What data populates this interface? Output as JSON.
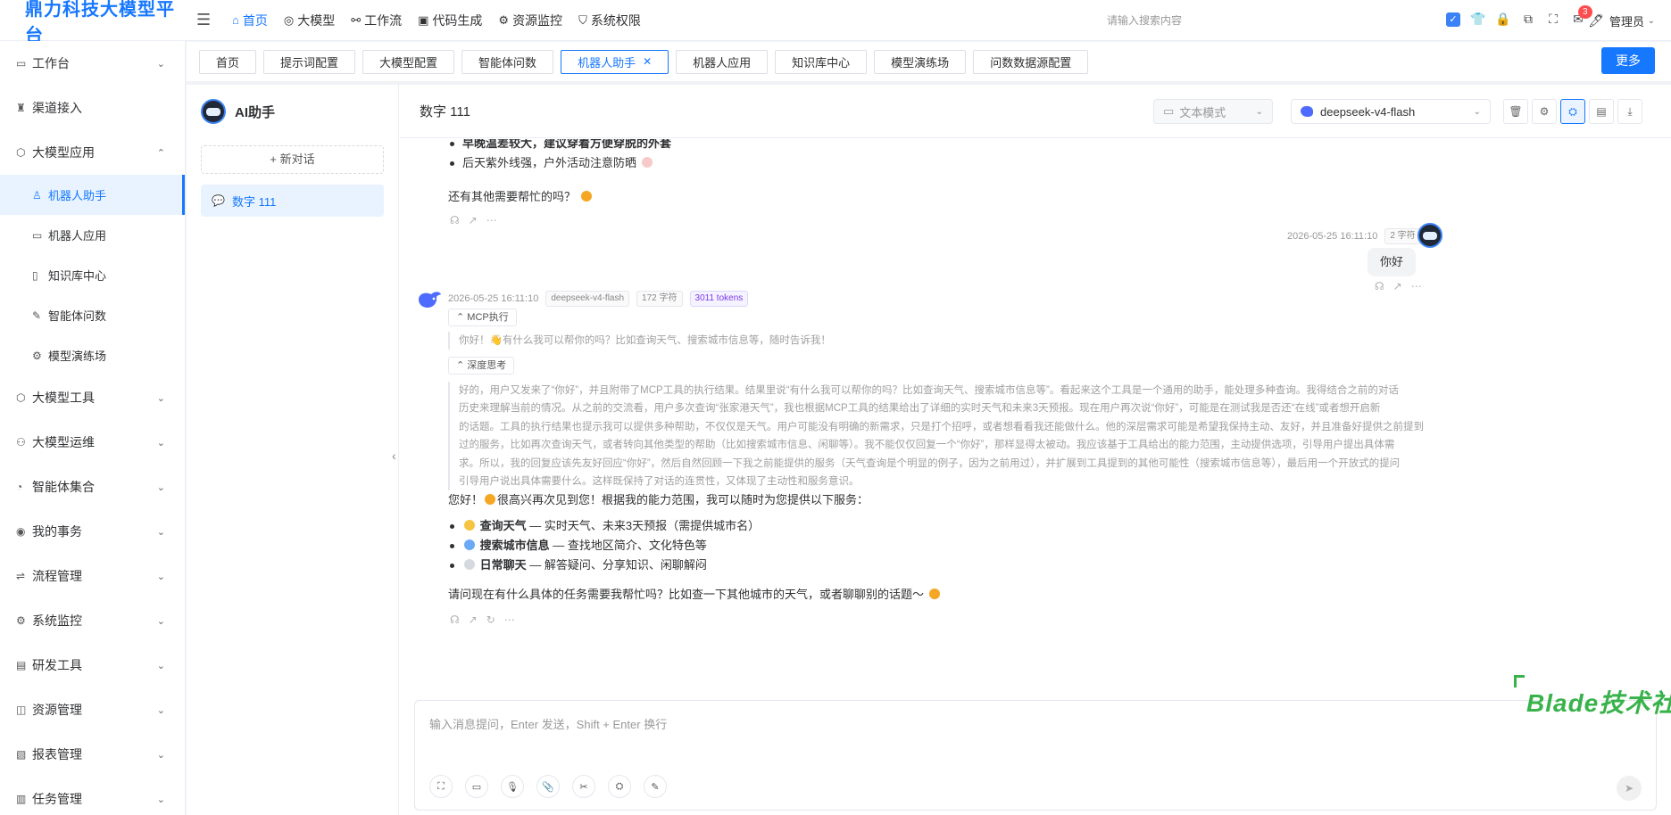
{
  "header": {
    "brand": "鼎力科技大模型平台",
    "nav": [
      {
        "label": "首页",
        "icon": "home-icon"
      },
      {
        "label": "大模型",
        "icon": "model-icon"
      },
      {
        "label": "工作流",
        "icon": "workflow-icon"
      },
      {
        "label": "代码生成",
        "icon": "code-icon"
      },
      {
        "label": "资源监控",
        "icon": "monitor-icon"
      },
      {
        "label": "系统权限",
        "icon": "shield-icon"
      }
    ],
    "search_placeholder": "请输入搜索内容",
    "notification_count": "3",
    "user": "管理员"
  },
  "sidebar": {
    "items": [
      {
        "label": "工作台"
      },
      {
        "label": "渠道接入"
      },
      {
        "label": "大模型应用"
      },
      {
        "label": "大模型工具"
      },
      {
        "label": "大模型运维"
      },
      {
        "label": "智能体集合"
      },
      {
        "label": "我的事务"
      },
      {
        "label": "流程管理"
      },
      {
        "label": "系统监控"
      },
      {
        "label": "研发工具"
      },
      {
        "label": "资源管理"
      },
      {
        "label": "报表管理"
      },
      {
        "label": "任务管理"
      }
    ],
    "subitems": [
      {
        "label": "机器人助手"
      },
      {
        "label": "机器人应用"
      },
      {
        "label": "知识库中心"
      },
      {
        "label": "智能体问数"
      },
      {
        "label": "模型演练场"
      }
    ]
  },
  "tabs": [
    {
      "label": "首页"
    },
    {
      "label": "提示词配置"
    },
    {
      "label": "大模型配置"
    },
    {
      "label": "智能体问数"
    },
    {
      "label": "机器人助手"
    },
    {
      "label": "机器人应用"
    },
    {
      "label": "知识库中心"
    },
    {
      "label": "模型演练场"
    },
    {
      "label": "问数数据源配置"
    }
  ],
  "more_button": "更多",
  "assistant": {
    "title": "AI助手",
    "new_conversation": "+ 新对话",
    "conversations": [
      {
        "label": "数字 111"
      }
    ]
  },
  "chat": {
    "title": "数字 111",
    "mode": "文本模式",
    "model": "deepseek-v4-flash",
    "prev_bullets": [
      {
        "text": "早晚温差较大，建议穿着方便穿脱的外套"
      },
      {
        "text": "后天紫外线强，户外活动注意防晒"
      }
    ],
    "prev_closing": "还有其他需要帮忙的吗？",
    "user_msg": {
      "time": "2026-05-25 16:11:10",
      "chars": "2 字符",
      "text": "你好"
    },
    "ai_msg": {
      "time": "2026-05-25 16:11:10",
      "model": "deepseek-v4-flash",
      "chars": "172 字符",
      "tokens": "3011 tokens",
      "mcp_label": "MCP执行",
      "mcp_result": "你好！👋有什么我可以帮你的吗？比如查询天气、搜索城市信息等，随时告诉我！",
      "think_label": "深度思考",
      "think_lines": [
        "好的，用户又发来了“你好”，并且附带了MCP工具的执行结果。结果里说“有什么我可以帮你的吗？比如查询天气、搜索城市信息等”。看起来这个工具是一个通用的助手，能处理多种查询。我得结合之前的对话",
        "历史来理解当前的情况。从之前的交流看，用户多次查询“张家港天气”，我也根据MCP工具的结果给出了详细的实时天气和未来3天预报。现在用户再次说“你好”，可能是在测试我是否还“在线”或者想开启新",
        "的话题。工具的执行结果也提示我可以提供多种帮助，不仅仅是天气。用户可能没有明确的新需求，只是打个招呼，或者想看看我还能做什么。他的深层需求可能是希望我保持主动、友好，并且准备好提供之前提到",
        "过的服务，比如再次查询天气，或者转向其他类型的帮助（比如搜索城市信息、闲聊等）。我不能仅仅回复一个“你好”，那样显得太被动。我应该基于工具给出的能力范围，主动提供选项，引导用户提出具体需",
        "求。所以，我的回复应该先友好回应“你好”，然后自然回顾一下我之前能提供的服务（天气查询是个明显的例子，因为之前用过），并扩展到工具提到的其他可能性（搜索城市信息等），最后用一个开放式的提问",
        "引导用户说出具体需要什么。这样既保持了对话的连贯性，又体现了主动性和服务意识。"
      ],
      "greeting_a": "您好！",
      "greeting_b": "很高兴再次见到您！根据我的能力范围，我可以随时为您提供以下服务：",
      "services": [
        {
          "name": "查询天气",
          "desc": "— 实时天气、未来3天预报（需提供城市名）"
        },
        {
          "name": "搜索城市信息",
          "desc": "— 查找地区简介、文化特色等"
        },
        {
          "name": "日常聊天",
          "desc": "— 解答疑问、分享知识、闲聊解闷"
        }
      ],
      "closing": "请问现在有什么具体的任务需要我帮忙吗？比如查一下其他城市的天气，或者聊聊别的话题～"
    },
    "input_placeholder": "输入消息提问，Enter 发送，Shift + Enter 换行",
    "watermark": "Blade技术社区"
  }
}
